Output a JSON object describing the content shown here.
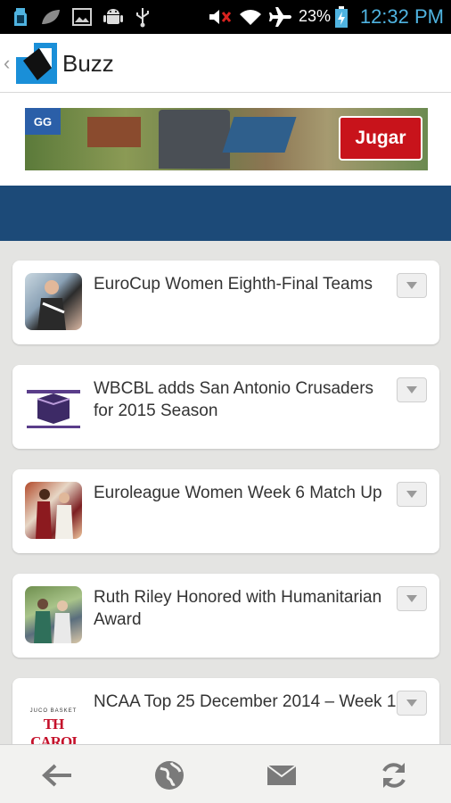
{
  "status_bar": {
    "battery_percent": "23%",
    "time": "12:32 PM",
    "icons": [
      "sd-card-icon",
      "leaf-icon",
      "image-icon",
      "android-icon",
      "usb-icon",
      "volume-muted-icon",
      "wifi-icon",
      "airplane-icon",
      "battery-charging-icon"
    ]
  },
  "app_bar": {
    "title": "Buzz",
    "up_icon": "chevron-left-icon",
    "logo": "buzz-app-logo"
  },
  "ad": {
    "logo_text": "GG",
    "button_label": "Jugar",
    "button_color": "#c8131b"
  },
  "theme": {
    "band_color": "#1c4a78",
    "background": "#e4e4e2"
  },
  "feed": {
    "items": [
      {
        "title": "EuroCup Women Eighth-Final Teams"
      },
      {
        "title": "WBCBL adds San Antonio Crusaders for 2015 Season"
      },
      {
        "title": "Euroleague Women Week 6 Match Up"
      },
      {
        "title": "Ruth Riley Honored with Humanitarian Award"
      },
      {
        "title": "NCAA Top 25 December 2014 – Week 1",
        "thumb_small_text": "JUCO BASKET",
        "thumb_big_text": "TH CAROI"
      }
    ]
  },
  "bottom_nav": {
    "items": [
      "back-arrow-icon",
      "globe-icon",
      "mail-icon",
      "refresh-icon"
    ]
  }
}
